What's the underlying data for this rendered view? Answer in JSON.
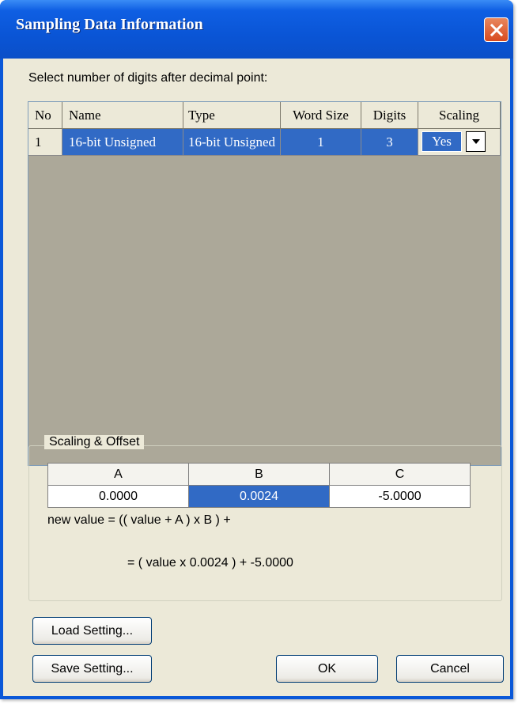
{
  "window": {
    "title": "Sampling Data Information"
  },
  "prompt": "Select number of digits after decimal point:",
  "grid": {
    "columns": [
      "No",
      "Name",
      "Type",
      "Word Size",
      "Digits",
      "Scaling"
    ],
    "rows": [
      {
        "no": "1",
        "name": "16-bit Unsigned",
        "type": "16-bit Unsigned",
        "word_size": "1",
        "digits": "3",
        "scaling": "Yes"
      }
    ]
  },
  "scaling_offset": {
    "title": "Scaling & Offset",
    "headers": [
      "A",
      "B",
      "C"
    ],
    "values": [
      "0.0000",
      "0.0024",
      "-5.0000"
    ],
    "formula_line1": "new value = (( value + A ) x B ) +",
    "formula_line2": "= ( value x 0.0024 ) + -5.0000"
  },
  "buttons": {
    "load": "Load Setting...",
    "save": "Save Setting...",
    "ok": "OK",
    "cancel": "Cancel"
  },
  "colors": {
    "titlebar": "#0a55d6",
    "selection": "#316ac5",
    "face": "#ece9d8",
    "close": "#d84a1e"
  }
}
